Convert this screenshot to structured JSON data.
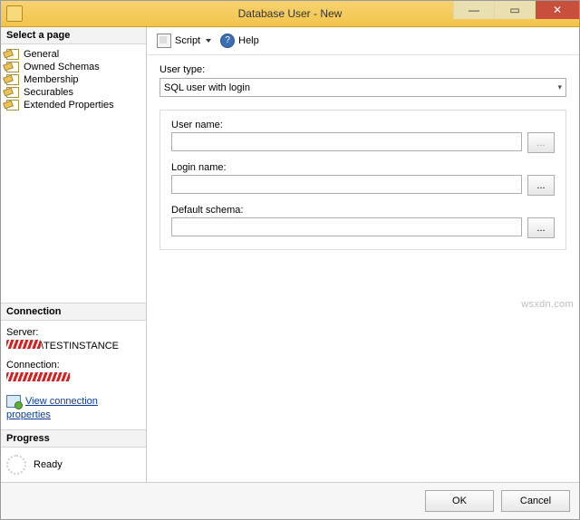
{
  "window": {
    "title": "Database User - New"
  },
  "sidebar": {
    "select_heading": "Select a page",
    "pages": [
      {
        "label": "General"
      },
      {
        "label": "Owned Schemas"
      },
      {
        "label": "Membership"
      },
      {
        "label": "Securables"
      },
      {
        "label": "Extended Properties"
      }
    ],
    "connection_heading": "Connection",
    "server_label": "Server:",
    "server_value_suffix": "\\TESTINSTANCE",
    "connection_label": "Connection:",
    "view_props_link": "View connection properties",
    "progress_heading": "Progress",
    "progress_status": "Ready"
  },
  "toolbar": {
    "script_label": "Script",
    "help_label": "Help"
  },
  "form": {
    "user_type_label": "User type:",
    "user_type_value": "SQL user with login",
    "user_name_label": "User name:",
    "user_name_value": "",
    "login_name_label": "Login name:",
    "login_name_value": "",
    "default_schema_label": "Default schema:",
    "default_schema_value": "",
    "browse_text": "..."
  },
  "buttons": {
    "ok": "OK",
    "cancel": "Cancel"
  },
  "watermark": "wsxdn.com"
}
